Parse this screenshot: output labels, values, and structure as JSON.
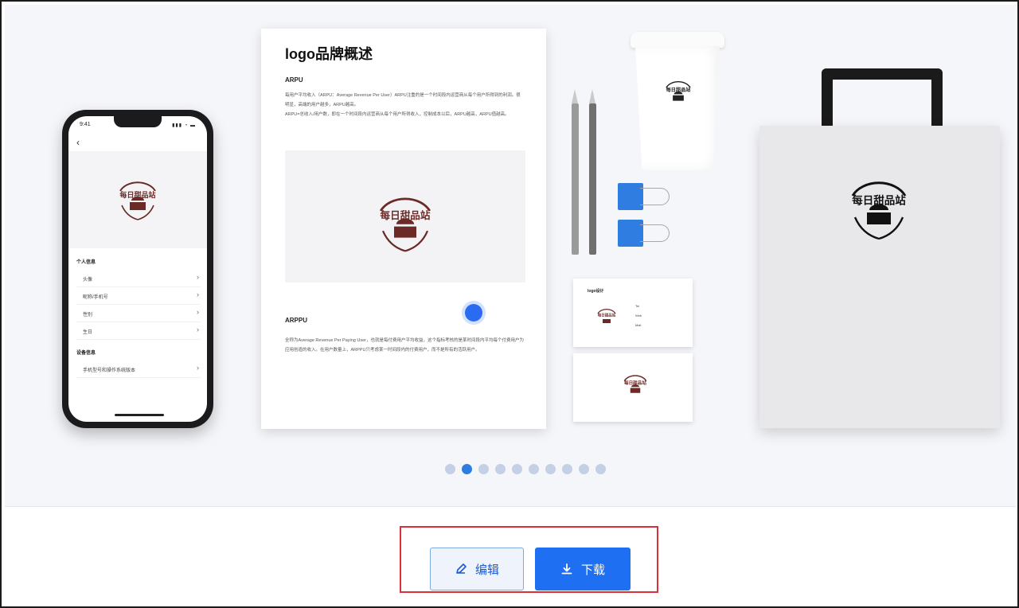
{
  "phone": {
    "time": "9:41",
    "status": "▮▮▮ ◔ ▬",
    "back": "‹",
    "brand_logo_text": "每日甜品站",
    "section_personal": "个人信息",
    "personal_rows": [
      "头像",
      "昵称/手机号",
      "性别",
      "生日"
    ],
    "section_security": "设备信息",
    "security_rows": [
      "手机型号和操作系统版本"
    ],
    "row_arrow": "›"
  },
  "document": {
    "title": "logo品牌概述",
    "subtitle1": "ARPU",
    "para1": "每用户平均收入（ARPU：Average Revenue Per User）ARPU注重的是一个时间段内运营商从每个用户所得到的利润。很明显，高端的用户越多，ARPU越高。",
    "para1b": "ARPU=总收入/用户数，即在一个时间段内运营商从每个用户所得收入，控制成本以后，ARPU越高，ARPU值越高。",
    "image_logo_text": "每日甜品站",
    "subtitle2": "ARPPU",
    "para2": "全称为Average Revenue Per Paying User，也就是每付费用户平均收益，这个指标考核的是某时间段内平均每个付费用户为应用创造的收入。在用户数量上，ARPPU只考虑某一时间段内的付费用户，而不是所有的活跃用户。"
  },
  "merch": {
    "cup_logo_text": "每日甜品站",
    "card_title": "logo设计",
    "card_lines": [
      "Tel",
      "Web",
      "Mail"
    ],
    "card_logo_text": "每日甜品站",
    "bag_logo_text": "每日甜品站"
  },
  "carousel": {
    "total_pages": 10,
    "current_page": 2
  },
  "actions": {
    "edit_label": "编辑",
    "download_label": "下载"
  },
  "colors": {
    "accent": "#1f6ff2",
    "highlight": "#d9303a",
    "logo_brown": "#6b2a26"
  }
}
